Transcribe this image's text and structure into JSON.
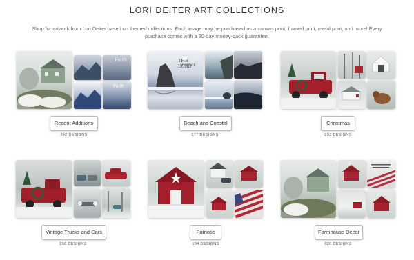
{
  "page": {
    "title": "LORI DEITER ART COLLECTIONS",
    "description": "Shop for artwork from Lori Deiter based on themed collections. Each image may be purchased as a canvas print, framed print, metal print, and more! Every purchase comes with a 30-day money-back guarantee."
  },
  "collections": [
    {
      "label": "Recent Additions",
      "count": "242 DESIGNS"
    },
    {
      "label": "Beach and Coastal",
      "count": "177 DESIGNS"
    },
    {
      "label": "Christmas",
      "count": "293 DESIGNS"
    },
    {
      "label": "Vintage Trucks and Cars",
      "count": "250 DESIGNS"
    },
    {
      "label": "Patriotic",
      "count": "104 DESIGNS"
    },
    {
      "label": "Farmhouse Decor",
      "count": "620 DESIGNS"
    }
  ],
  "artwork_text": {
    "faith_quote": "Faith",
    "lord_title": "THE LORD",
    "lord_subtitle": "MY ROCK"
  }
}
